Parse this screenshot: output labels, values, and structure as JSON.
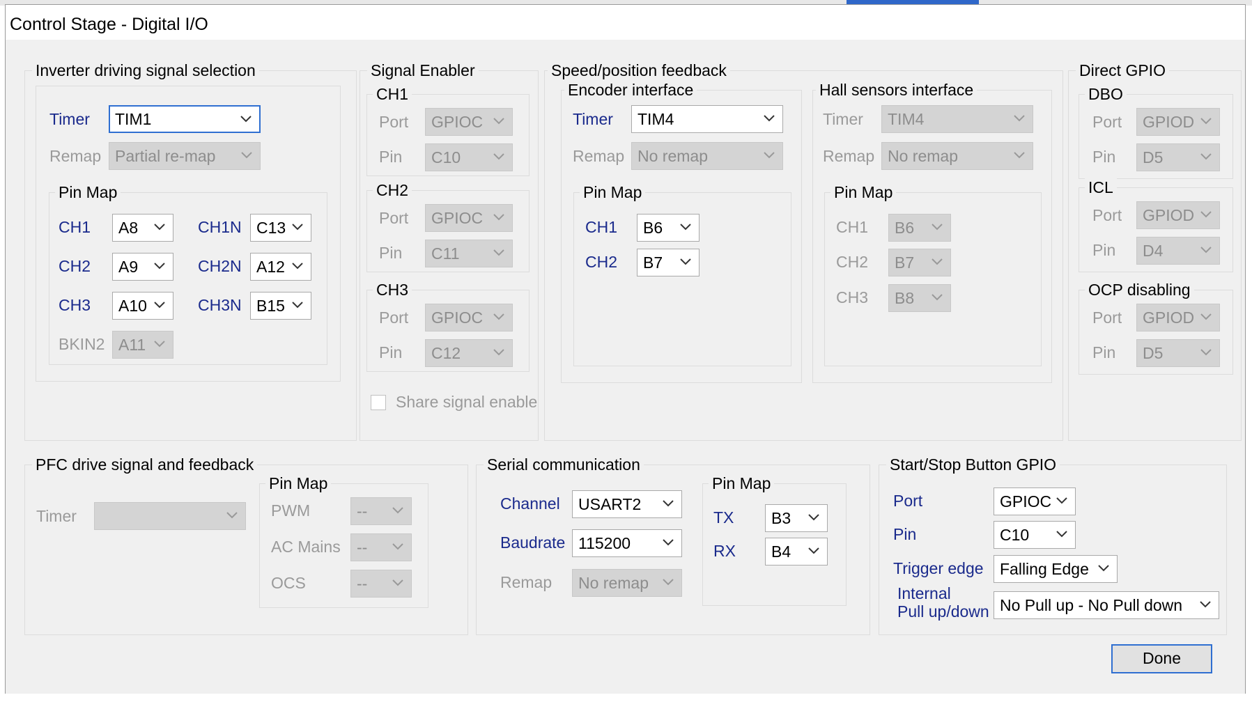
{
  "window": {
    "title": "Control Stage - Digital I/O"
  },
  "colors": {
    "label_blue": "#1a2a8c",
    "disabled_gray": "#9a9a9a",
    "focus_blue": "#2f6fd1",
    "panel_bg": "#f0f0f0"
  },
  "inverter": {
    "legend": "Inverter driving signal selection",
    "timer_label": "Timer",
    "timer_value": "TIM1",
    "remap_label": "Remap",
    "remap_value": "Partial re-map",
    "pinmap_legend": "Pin Map",
    "ch1_label": "CH1",
    "ch1_value": "A8",
    "ch1n_label": "CH1N",
    "ch1n_value": "C13",
    "ch2_label": "CH2",
    "ch2_value": "A9",
    "ch2n_label": "CH2N",
    "ch2n_value": "A12",
    "ch3_label": "CH3",
    "ch3_value": "A10",
    "ch3n_label": "CH3N",
    "ch3n_value": "B15",
    "bkin2_label": "BKIN2",
    "bkin2_value": "A11"
  },
  "enabler": {
    "legend": "Signal Enabler",
    "ch1": {
      "legend": "CH1",
      "port_label": "Port",
      "port_value": "GPIOC",
      "pin_label": "Pin",
      "pin_value": "C10"
    },
    "ch2": {
      "legend": "CH2",
      "port_label": "Port",
      "port_value": "GPIOC",
      "pin_label": "Pin",
      "pin_value": "C11"
    },
    "ch3": {
      "legend": "CH3",
      "port_label": "Port",
      "port_value": "GPIOC",
      "pin_label": "Pin",
      "pin_value": "C12"
    },
    "share_label": "Share signal enable",
    "share_checked": false
  },
  "feedback": {
    "legend": "Speed/position feedback",
    "encoder": {
      "legend": "Encoder interface",
      "timer_label": "Timer",
      "timer_value": "TIM4",
      "remap_label": "Remap",
      "remap_value": "No remap",
      "pinmap_legend": "Pin Map",
      "ch1_label": "CH1",
      "ch1_value": "B6",
      "ch2_label": "CH2",
      "ch2_value": "B7"
    },
    "hall": {
      "legend": "Hall sensors interface",
      "timer_label": "Timer",
      "timer_value": "TIM4",
      "remap_label": "Remap",
      "remap_value": "No remap",
      "pinmap_legend": "Pin Map",
      "ch1_label": "CH1",
      "ch1_value": "B6",
      "ch2_label": "CH2",
      "ch2_value": "B7",
      "ch3_label": "CH3",
      "ch3_value": "B8"
    }
  },
  "gpio": {
    "legend": "Direct GPIO",
    "dbo": {
      "legend": "DBO",
      "port_label": "Port",
      "port_value": "GPIOD",
      "pin_label": "Pin",
      "pin_value": "D5"
    },
    "icl": {
      "legend": "ICL",
      "port_label": "Port",
      "port_value": "GPIOD",
      "pin_label": "Pin",
      "pin_value": "D4"
    },
    "ocp": {
      "legend": "OCP disabling",
      "port_label": "Port",
      "port_value": "GPIOD",
      "pin_label": "Pin",
      "pin_value": "D5"
    }
  },
  "pfc": {
    "legend": "PFC drive signal and feedback",
    "timer_label": "Timer",
    "timer_value": "",
    "pinmap_legend": "Pin Map",
    "pwm_label": "PWM",
    "pwm_value": "--",
    "ac_label": "AC Mains",
    "ac_value": "--",
    "ocs_label": "OCS",
    "ocs_value": "--"
  },
  "serial": {
    "legend": "Serial communication",
    "channel_label": "Channel",
    "channel_value": "USART2",
    "baud_label": "Baudrate",
    "baud_value": "115200",
    "remap_label": "Remap",
    "remap_value": "No remap",
    "pinmap_legend": "Pin Map",
    "tx_label": "TX",
    "tx_value": "B3",
    "rx_label": "RX",
    "rx_value": "B4"
  },
  "startstop": {
    "legend": "Start/Stop Button GPIO",
    "port_label": "Port",
    "port_value": "GPIOC",
    "pin_label": "Pin",
    "pin_value": "C10",
    "trigger_label": "Trigger edge",
    "trigger_value": "Falling Edge",
    "pull_label_1": "Internal",
    "pull_label_2": "Pull up/down",
    "pull_value": "No Pull up - No Pull down"
  },
  "footer": {
    "done_label": "Done"
  }
}
